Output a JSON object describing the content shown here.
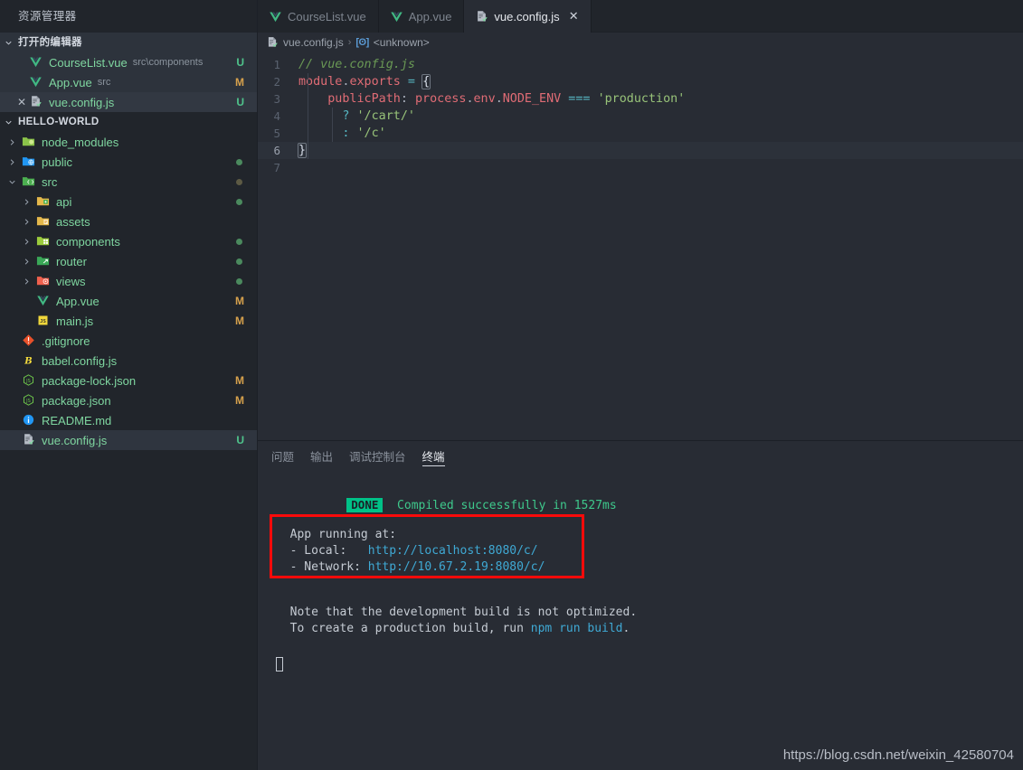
{
  "sidebar": {
    "title": "资源管理器",
    "open_editors": {
      "label": "打开的编辑器",
      "chevron": "⌄",
      "items": [
        {
          "icon": "vue-icon",
          "name": "CourseList.vue",
          "path": "src\\components",
          "status": "U",
          "closable": false,
          "selected": false
        },
        {
          "icon": "vue-icon",
          "name": "App.vue",
          "path": "src",
          "status": "M",
          "closable": false,
          "selected": false
        },
        {
          "icon": "js-config-icon",
          "name": "vue.config.js",
          "path": "",
          "status": "U",
          "closable": true,
          "selected": true
        }
      ]
    },
    "workspace": {
      "label": "HELLO-WORLD",
      "chevron": "⌄",
      "items": [
        {
          "name": "node_modules",
          "type": "folder",
          "icon": "folder-node-icon",
          "depth": 1,
          "expanded": false,
          "status": "",
          "dot": "none",
          "selected": false
        },
        {
          "name": "public",
          "type": "folder",
          "icon": "folder-public-icon",
          "depth": 1,
          "expanded": false,
          "status": "",
          "dot": "green",
          "selected": false
        },
        {
          "name": "src",
          "type": "folder",
          "icon": "folder-src-icon",
          "depth": 1,
          "expanded": true,
          "status": "",
          "dot": "dim",
          "selected": false
        },
        {
          "name": "api",
          "type": "folder",
          "icon": "folder-api-icon",
          "depth": 2,
          "expanded": false,
          "status": "",
          "dot": "green",
          "selected": false
        },
        {
          "name": "assets",
          "type": "folder",
          "icon": "folder-assets-icon",
          "depth": 2,
          "expanded": false,
          "status": "",
          "dot": "none",
          "selected": false
        },
        {
          "name": "components",
          "type": "folder",
          "icon": "folder-components-icon",
          "depth": 2,
          "expanded": false,
          "status": "",
          "dot": "green",
          "selected": false
        },
        {
          "name": "router",
          "type": "folder",
          "icon": "folder-router-icon",
          "depth": 2,
          "expanded": false,
          "status": "",
          "dot": "green",
          "selected": false
        },
        {
          "name": "views",
          "type": "folder",
          "icon": "folder-views-icon",
          "depth": 2,
          "expanded": false,
          "status": "",
          "dot": "green",
          "selected": false
        },
        {
          "name": "App.vue",
          "type": "file",
          "icon": "vue-icon",
          "depth": 2,
          "expanded": false,
          "status": "M",
          "dot": "none",
          "selected": false
        },
        {
          "name": "main.js",
          "type": "file",
          "icon": "js-icon",
          "depth": 2,
          "expanded": false,
          "status": "M",
          "dot": "none",
          "selected": false
        },
        {
          "name": ".gitignore",
          "type": "file",
          "icon": "git-icon",
          "depth": 1,
          "expanded": false,
          "status": "",
          "dot": "none",
          "selected": false
        },
        {
          "name": "babel.config.js",
          "type": "file",
          "icon": "babel-icon",
          "depth": 1,
          "expanded": false,
          "status": "",
          "dot": "none",
          "selected": false
        },
        {
          "name": "package-lock.json",
          "type": "file",
          "icon": "node-icon",
          "depth": 1,
          "expanded": false,
          "status": "M",
          "dot": "none",
          "selected": false
        },
        {
          "name": "package.json",
          "type": "file",
          "icon": "node-icon",
          "depth": 1,
          "expanded": false,
          "status": "M",
          "dot": "none",
          "selected": false
        },
        {
          "name": "README.md",
          "type": "file",
          "icon": "info-icon",
          "depth": 1,
          "expanded": false,
          "status": "",
          "dot": "none",
          "selected": false
        },
        {
          "name": "vue.config.js",
          "type": "file",
          "icon": "js-config-icon",
          "depth": 1,
          "expanded": false,
          "status": "U",
          "dot": "none",
          "selected": true
        }
      ]
    }
  },
  "tabs": [
    {
      "label": "CourseList.vue",
      "icon": "vue-icon",
      "active": false,
      "closable": false
    },
    {
      "label": "App.vue",
      "icon": "vue-icon",
      "active": false,
      "closable": false
    },
    {
      "label": "vue.config.js",
      "icon": "js-config-icon",
      "active": true,
      "closable": true,
      "close_glyph": "✕"
    }
  ],
  "breadcrumb": {
    "file": "vue.config.js",
    "separator": "›",
    "symbol_icon": "[ʘ]",
    "symbol": "<unknown>"
  },
  "editor": {
    "lines": [
      {
        "n": "1",
        "current": false
      },
      {
        "n": "2",
        "current": false
      },
      {
        "n": "3",
        "current": false
      },
      {
        "n": "4",
        "current": false
      },
      {
        "n": "5",
        "current": false
      },
      {
        "n": "6",
        "current": true
      },
      {
        "n": "7",
        "current": false
      }
    ],
    "code": {
      "l1_comment": "// vue.config.js",
      "l2_module": "module",
      "l2_dot": ".",
      "l2_exports": "exports",
      "l2_eq": " = ",
      "l2_brace": "{",
      "l3_indent": "    ",
      "l3_key": "publicPath",
      "l3_colon": ": ",
      "l3_process": "process",
      "l3_dot1": ".",
      "l3_env": "env",
      "l3_dot2": ".",
      "l3_nodeenv": "NODE_ENV",
      "l3_eqeq": " === ",
      "l3_str": "'production'",
      "l4_indent": "      ",
      "l4_q": "?",
      "l4_str": " '/cart/'",
      "l5_indent": "      ",
      "l5_c": ":",
      "l5_str": " '/c'",
      "l6_brace": "}"
    }
  },
  "panel": {
    "tabs": [
      {
        "label": "问题",
        "active": false
      },
      {
        "label": "输出",
        "active": false
      },
      {
        "label": "调试控制台",
        "active": false
      },
      {
        "label": "终端",
        "active": true
      }
    ],
    "terminal": {
      "done_badge": "DONE",
      "done_message": "Compiled successfully in 1527ms",
      "app_running": "  App running at:",
      "local_label": "  - Local:   ",
      "local_url": "http://localhost:8080/c/",
      "network_label": "  - Network: ",
      "network_url": "http://10.67.2.19:8080/c/",
      "note_line1": "  Note that the development build is not optimized.",
      "note_line2_a": "  To create a production build, run ",
      "note_line2_cmd": "npm run build",
      "note_line2_b": "."
    },
    "highlight_box_color": "#fb0a0a"
  },
  "watermark": "https://blog.csdn.net/weixin_42580704",
  "colors": {
    "sidebar_bg": "#21252b",
    "editor_bg": "#282c34",
    "accent_green": "#4fc48c",
    "accent_modified": "#d6a14c",
    "done_badge": "#00c187",
    "highlight_red": "#fb0a0a"
  }
}
